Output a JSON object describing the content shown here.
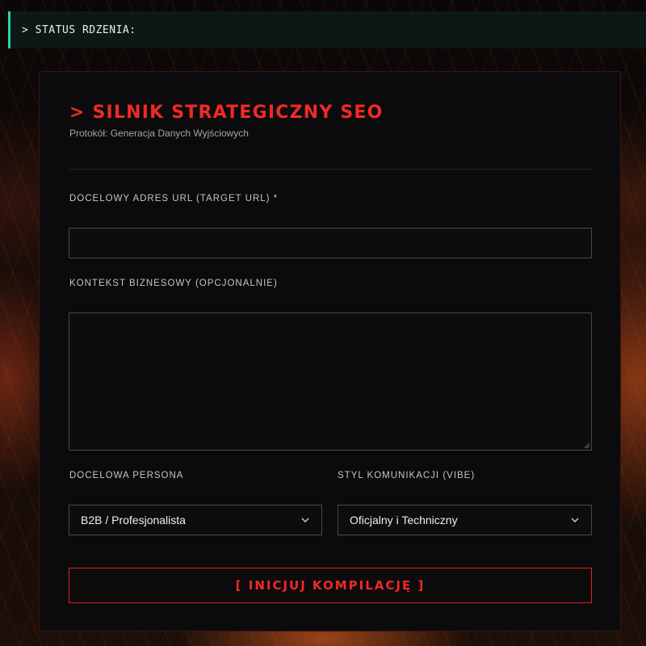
{
  "status": {
    "text": "> STATUS RDZENIA:"
  },
  "panel": {
    "title": "> SILNIK STRATEGICZNY SEO",
    "subtitle": "Protokół: Generacja Danych Wyjściowych"
  },
  "form": {
    "target_url": {
      "label": "DOCELOWY ADRES URL (TARGET URL) *",
      "value": "",
      "placeholder": ""
    },
    "business_context": {
      "label": "KONTEKST BIZNESOWY (OPCJONALNIE)",
      "value": "",
      "placeholder": ""
    },
    "persona": {
      "label": "DOCELOWA PERSONA",
      "selected": "B2B / Profesjonalista"
    },
    "vibe": {
      "label": "STYL KOMUNIKACJI (VIBE)",
      "selected": "Oficjalny i Techniczny"
    },
    "submit_label": "[ INICJUJ KOMPILACJĘ ]"
  },
  "colors": {
    "accent_red": "#f02a24",
    "status_accent": "#2fd0a9",
    "panel_bg": "#0b0b0d"
  },
  "icons": {
    "select_arrow": "chevron-down-icon",
    "textarea_resize": "resize-handle-icon"
  }
}
